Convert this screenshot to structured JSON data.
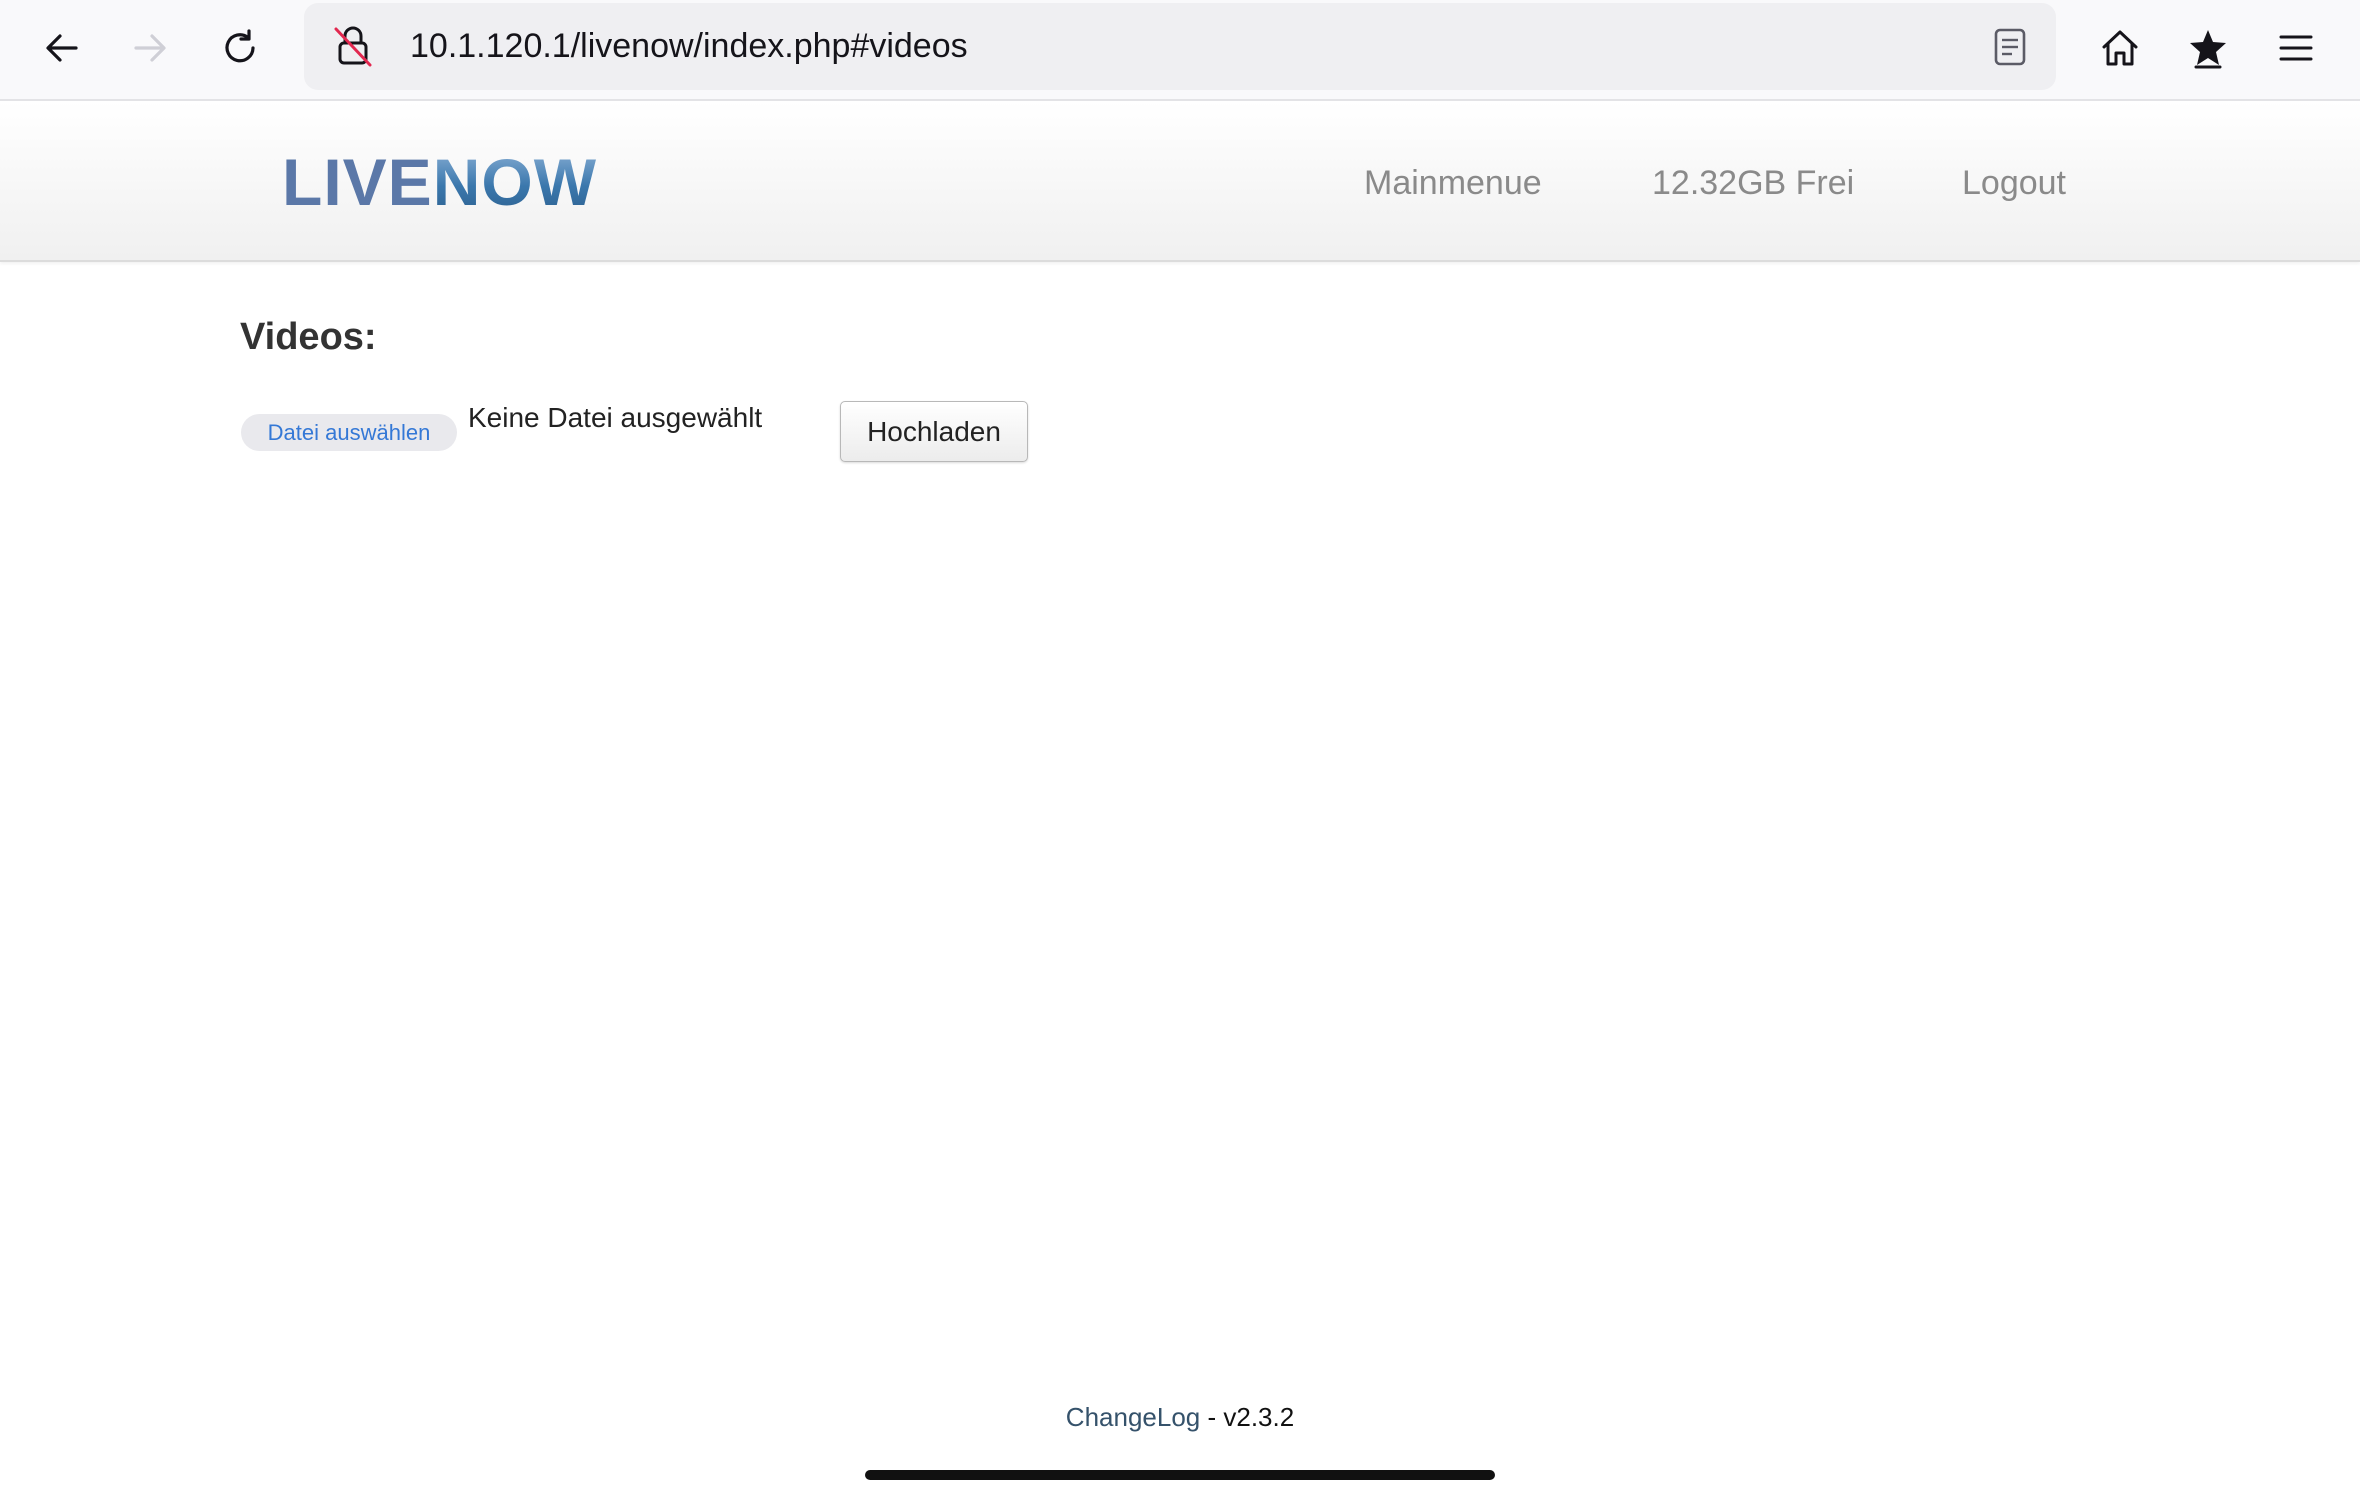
{
  "browser": {
    "url": "10.1.120.1/livenow/index.php#videos",
    "icons": {
      "back": "arrow-left-icon",
      "forward": "arrow-right-icon",
      "reload": "reload-icon",
      "insecure": "insecure-lock-icon",
      "reader": "reader-view-icon",
      "home": "home-icon",
      "bookmarks": "star-icon",
      "menu": "hamburger-menu-icon"
    }
  },
  "header": {
    "logo": {
      "part1": "LIVE",
      "part2": "NOW"
    },
    "nav": {
      "mainmenu": "Mainmenue",
      "storage": "12.32GB Frei",
      "logout": "Logout"
    }
  },
  "main": {
    "title": "Videos:",
    "file_button": "Datei auswählen",
    "file_status": "Keine Datei ausgewählt",
    "upload_button": "Hochladen"
  },
  "footer": {
    "changelog": "ChangeLog",
    "separator": " - ",
    "version": "v2.3.2"
  },
  "colors": {
    "accent_link": "#3478d6",
    "logo_live": "#5b78a8",
    "logo_now": "#3b78ad",
    "nav_text": "#8a8a8a"
  }
}
